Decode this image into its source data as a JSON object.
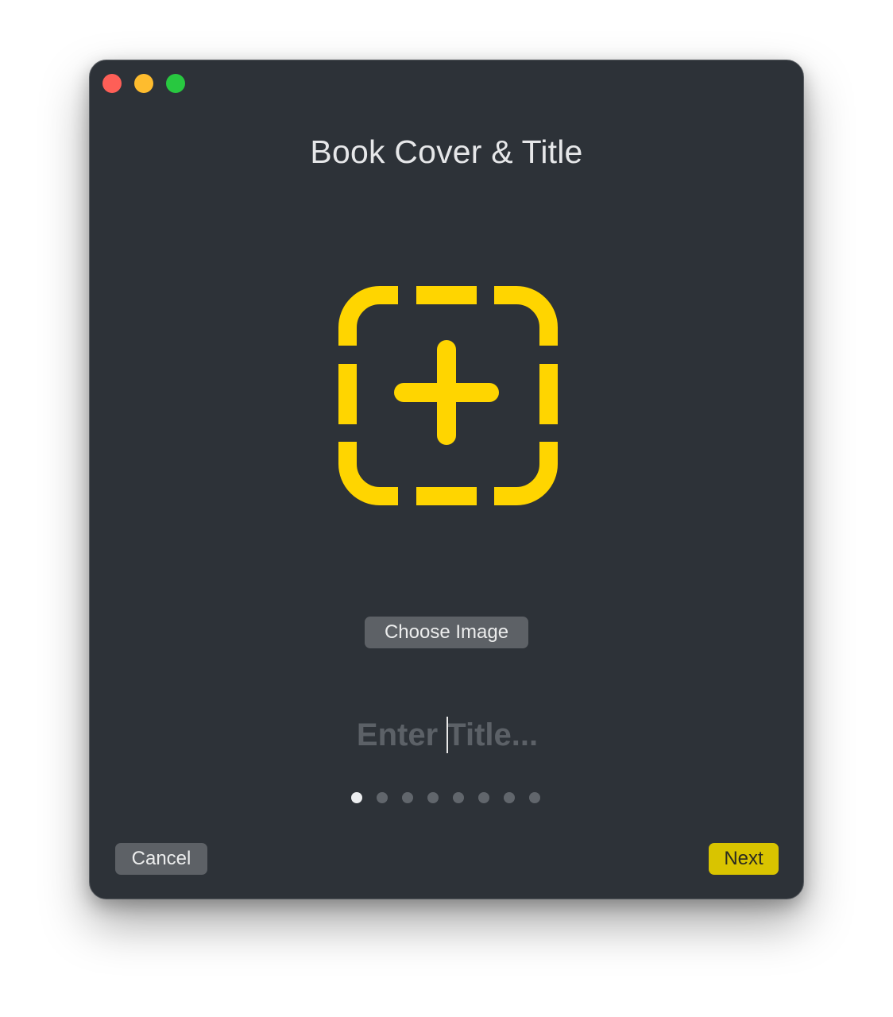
{
  "window": {
    "title": "Book Cover & Title",
    "controls": [
      "close",
      "minimize",
      "zoom"
    ]
  },
  "cover": {
    "icon": "dashed-square-plus-icon",
    "accent_color": "#ffd500"
  },
  "choose_image": {
    "label": "Choose Image"
  },
  "title_field": {
    "value": "",
    "placeholder": "Enter Title..."
  },
  "pagination": {
    "total": 8,
    "current": 1
  },
  "footer": {
    "cancel_label": "Cancel",
    "next_label": "Next"
  }
}
